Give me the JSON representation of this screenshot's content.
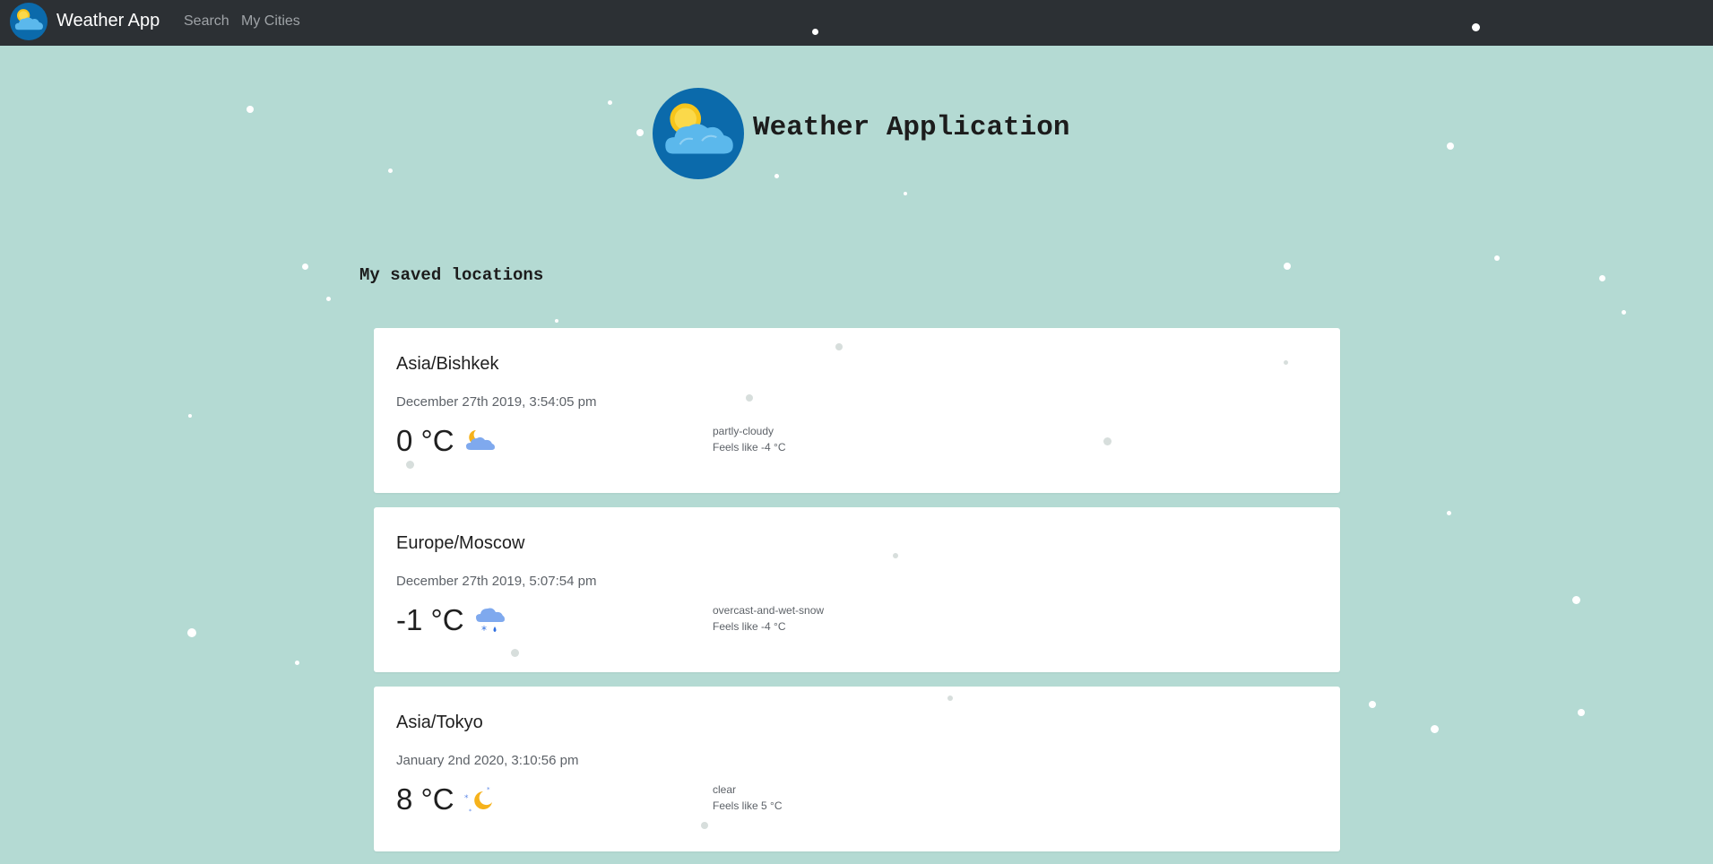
{
  "navbar": {
    "brand": "Weather App",
    "links": [
      "Search",
      "My Cities"
    ],
    "logo_icon": "sun-cloud-icon"
  },
  "header": {
    "title": "Weather Application",
    "logo_icon": "sun-cloud-icon"
  },
  "section": {
    "title": "My saved locations"
  },
  "locations": [
    {
      "city": "Asia/Bishkek",
      "datetime": "December 27th 2019, 3:54:05 pm",
      "temp": "0 °C",
      "icon": "partly-cloudy-night-icon",
      "description": "partly-cloudy",
      "feels_like": "Feels like -4 °C"
    },
    {
      "city": "Europe/Moscow",
      "datetime": "December 27th 2019, 5:07:54 pm",
      "temp": "-1 °C",
      "icon": "wet-snow-icon",
      "description": "overcast-and-wet-snow",
      "feels_like": "Feels like -4 °C"
    },
    {
      "city": "Asia/Tokyo",
      "datetime": "January 2nd 2020, 3:10:56 pm",
      "temp": "8 °C",
      "icon": "clear-night-icon",
      "description": "clear",
      "feels_like": "Feels like 5 °C"
    }
  ],
  "colors": {
    "background": "#b4dad3",
    "navbar": "#2c3034",
    "card": "#ffffff",
    "logo_circle": "#0b6aab",
    "cloud": "#5bb8ec",
    "sun": "#f7c51b"
  }
}
